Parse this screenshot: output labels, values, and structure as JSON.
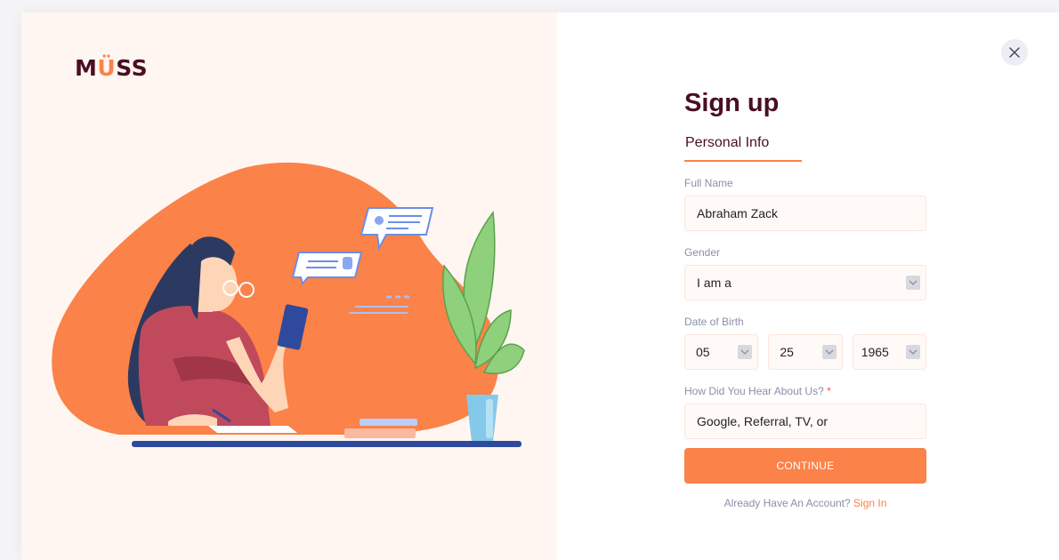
{
  "brand": {
    "logo_prefix": "M",
    "logo_u": "Ü",
    "logo_suffix": "SS"
  },
  "form": {
    "title": "Sign up",
    "tab": "Personal Info",
    "full_name": {
      "label": "Full Name",
      "value": "Abraham Zack"
    },
    "gender": {
      "label": "Gender",
      "value": "I am a"
    },
    "dob": {
      "label": "Date of Birth",
      "month": "05",
      "day": "25",
      "year": "1965"
    },
    "source": {
      "label": "How Did You Hear About Us?",
      "required_mark": "*",
      "value": "Google, Referral, TV, or"
    },
    "continue_label": "CONTINUE",
    "account_prompt": "Already Have An Account?",
    "signin_label": "Sign In"
  },
  "colors": {
    "accent": "#fb8248",
    "brand_dark": "#4a0f23",
    "left_panel_bg": "#fff6f1"
  },
  "icons": {
    "close": "close-icon",
    "select": "chevron-down-icon"
  }
}
